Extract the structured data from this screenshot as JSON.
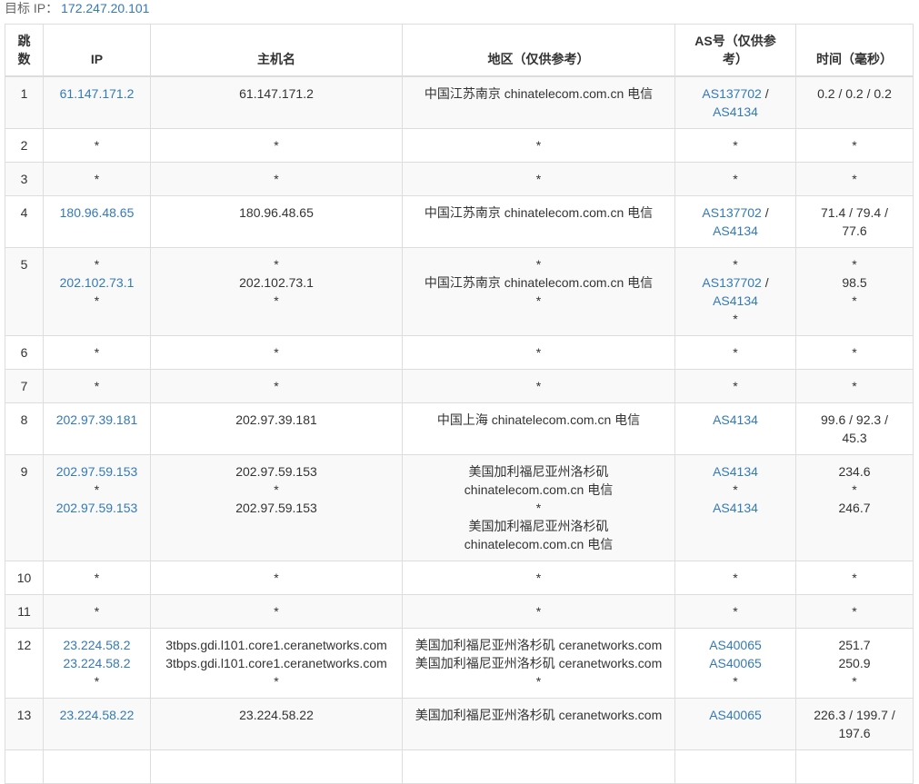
{
  "target": {
    "label": "目标 IP：",
    "ip": "172.247.20.101"
  },
  "headers": {
    "hop": "跳数",
    "ip": "IP",
    "hostname": "主机名",
    "region": "地区（仅供参考）",
    "asn": "AS号（仅供参考）",
    "time": "时间（毫秒）"
  },
  "rows": [
    {
      "hop": "1",
      "ip": [
        [
          "61.147.171.2"
        ]
      ],
      "host": [
        [
          "61.147.171.2"
        ]
      ],
      "region": [
        [
          "中国江苏南京 chinatelecom.com.cn 电信"
        ]
      ],
      "as": [
        [
          "AS137702",
          " / "
        ],
        [
          "AS4134"
        ]
      ],
      "time": [
        [
          "0.2 / 0.2 / 0.2"
        ]
      ]
    },
    {
      "hop": "2",
      "ip": [
        [
          "*"
        ]
      ],
      "host": [
        [
          "*"
        ]
      ],
      "region": [
        [
          "*"
        ]
      ],
      "as": [
        [
          "*"
        ]
      ],
      "time": [
        [
          "*"
        ]
      ]
    },
    {
      "hop": "3",
      "ip": [
        [
          "*"
        ]
      ],
      "host": [
        [
          "*"
        ]
      ],
      "region": [
        [
          "*"
        ]
      ],
      "as": [
        [
          "*"
        ]
      ],
      "time": [
        [
          "*"
        ]
      ]
    },
    {
      "hop": "4",
      "ip": [
        [
          "180.96.48.65"
        ]
      ],
      "host": [
        [
          "180.96.48.65"
        ]
      ],
      "region": [
        [
          "中国江苏南京 chinatelecom.com.cn 电信"
        ]
      ],
      "as": [
        [
          "AS137702",
          " / "
        ],
        [
          "AS4134"
        ]
      ],
      "time": [
        [
          "71.4 / 79.4 /"
        ],
        [
          "77.6"
        ]
      ]
    },
    {
      "hop": "5",
      "ip": [
        [
          "*"
        ],
        [
          "202.102.73.1"
        ],
        [
          "*"
        ]
      ],
      "host": [
        [
          "*"
        ],
        [
          "202.102.73.1"
        ],
        [
          "*"
        ]
      ],
      "region": [
        [
          "*"
        ],
        [
          "中国江苏南京 chinatelecom.com.cn 电信"
        ],
        [
          "*"
        ]
      ],
      "as": [
        [
          "*"
        ],
        [
          "AS137702",
          " / "
        ],
        [
          "AS4134"
        ],
        [
          "*"
        ]
      ],
      "time": [
        [
          "*"
        ],
        [
          "98.5"
        ],
        [
          "*"
        ]
      ]
    },
    {
      "hop": "6",
      "ip": [
        [
          "*"
        ]
      ],
      "host": [
        [
          "*"
        ]
      ],
      "region": [
        [
          "*"
        ]
      ],
      "as": [
        [
          "*"
        ]
      ],
      "time": [
        [
          "*"
        ]
      ]
    },
    {
      "hop": "7",
      "ip": [
        [
          "*"
        ]
      ],
      "host": [
        [
          "*"
        ]
      ],
      "region": [
        [
          "*"
        ]
      ],
      "as": [
        [
          "*"
        ]
      ],
      "time": [
        [
          "*"
        ]
      ]
    },
    {
      "hop": "8",
      "ip": [
        [
          "202.97.39.181"
        ]
      ],
      "host": [
        [
          "202.97.39.181"
        ]
      ],
      "region": [
        [
          "中国上海 chinatelecom.com.cn 电信"
        ]
      ],
      "as": [
        [
          "AS4134"
        ]
      ],
      "time": [
        [
          "99.6 / 92.3 /"
        ],
        [
          "45.3"
        ]
      ]
    },
    {
      "hop": "9",
      "ip": [
        [
          "202.97.59.153"
        ],
        [
          "*"
        ],
        [
          "202.97.59.153"
        ]
      ],
      "host": [
        [
          "202.97.59.153"
        ],
        [
          "*"
        ],
        [
          "202.97.59.153"
        ]
      ],
      "region": [
        [
          "美国加利福尼亚州洛杉矶"
        ],
        [
          "chinatelecom.com.cn 电信"
        ],
        [
          "*"
        ],
        [
          "美国加利福尼亚州洛杉矶"
        ],
        [
          "chinatelecom.com.cn 电信"
        ]
      ],
      "as": [
        [
          "AS4134"
        ],
        [
          "*"
        ],
        [
          "AS4134"
        ]
      ],
      "time": [
        [
          "234.6"
        ],
        [
          "*"
        ],
        [
          "246.7"
        ]
      ]
    },
    {
      "hop": "10",
      "ip": [
        [
          "*"
        ]
      ],
      "host": [
        [
          "*"
        ]
      ],
      "region": [
        [
          "*"
        ]
      ],
      "as": [
        [
          "*"
        ]
      ],
      "time": [
        [
          "*"
        ]
      ]
    },
    {
      "hop": "11",
      "ip": [
        [
          "*"
        ]
      ],
      "host": [
        [
          "*"
        ]
      ],
      "region": [
        [
          "*"
        ]
      ],
      "as": [
        [
          "*"
        ]
      ],
      "time": [
        [
          "*"
        ]
      ]
    },
    {
      "hop": "12",
      "ip": [
        [
          "23.224.58.2"
        ],
        [
          "23.224.58.2"
        ],
        [
          "*"
        ]
      ],
      "host": [
        [
          "3tbps.gdi.l101.core1.ceranetworks.com"
        ],
        [
          "3tbps.gdi.l101.core1.ceranetworks.com"
        ],
        [
          "*"
        ]
      ],
      "region": [
        [
          "美国加利福尼亚州洛杉矶 ceranetworks.com"
        ],
        [
          "美国加利福尼亚州洛杉矶 ceranetworks.com"
        ],
        [
          "*"
        ]
      ],
      "as": [
        [
          "AS40065"
        ],
        [
          "AS40065"
        ],
        [
          "*"
        ]
      ],
      "time": [
        [
          "251.7"
        ],
        [
          "250.9"
        ],
        [
          "*"
        ]
      ]
    },
    {
      "hop": "13",
      "ip": [
        [
          "23.224.58.22"
        ]
      ],
      "host": [
        [
          "23.224.58.22"
        ]
      ],
      "region": [
        [
          "美国加利福尼亚州洛杉矶 ceranetworks.com"
        ]
      ],
      "as": [
        [
          "AS40065"
        ]
      ],
      "time": [
        [
          "226.3 / 199.7 /"
        ],
        [
          "197.6"
        ]
      ]
    },
    {
      "hop": "",
      "ip": [
        [
          ""
        ]
      ],
      "host": [
        [
          ""
        ]
      ],
      "region": [
        [
          ""
        ]
      ],
      "as": [
        [
          ""
        ]
      ],
      "time": [
        [
          ""
        ]
      ]
    }
  ]
}
